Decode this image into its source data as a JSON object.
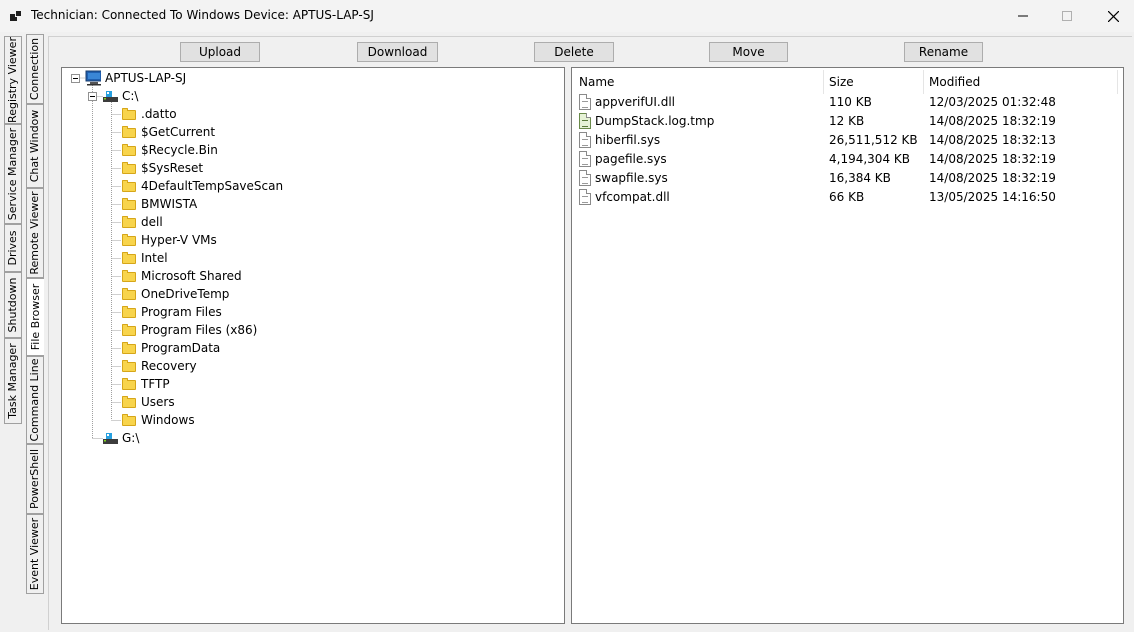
{
  "window": {
    "title": "Technician: Connected To Windows Device: APTUS-LAP-SJ"
  },
  "sidebar": {
    "outer_tabs": [
      "Registry Viewer",
      "Service Manager",
      "Drives",
      "Shutdown",
      "Task Manager"
    ],
    "inner_tabs": [
      "Connection",
      "Chat Window",
      "Remote Viewer",
      "File Browser",
      "Command Line",
      "PowerShell",
      "Event Viewer"
    ]
  },
  "toolbar": {
    "upload_label": "Upload",
    "download_label": "Download",
    "delete_label": "Delete",
    "move_label": "Move",
    "rename_label": "Rename"
  },
  "tree": {
    "root": "APTUS-LAP-SJ",
    "drive_c": "C:\\",
    "folders": [
      ".datto",
      "$GetCurrent",
      "$Recycle.Bin",
      "$SysReset",
      "4DefaultTempSaveScan",
      "BMWISTA",
      "dell",
      "Hyper-V VMs",
      "Intel",
      "Microsoft Shared",
      "OneDriveTemp",
      "Program Files",
      "Program Files (x86)",
      "ProgramData",
      "Recovery",
      "TFTP",
      "Users",
      "Windows"
    ],
    "drive_g": "G:\\"
  },
  "file_list": {
    "columns": [
      "Name",
      "Size",
      "Modified"
    ],
    "rows": [
      {
        "name": "appverifUI.dll",
        "size": "110 KB",
        "modified": "12/03/2025 01:32:48",
        "icon": "dll-file-icon"
      },
      {
        "name": "DumpStack.log.tmp",
        "size": "12 KB",
        "modified": "14/08/2025 18:32:19",
        "icon": "tmp-file-icon"
      },
      {
        "name": "hiberfil.sys",
        "size": "26,511,512 KB",
        "modified": "14/08/2025 18:32:13",
        "icon": "sys-file-icon"
      },
      {
        "name": "pagefile.sys",
        "size": "4,194,304 KB",
        "modified": "14/08/2025 18:32:19",
        "icon": "sys-file-icon"
      },
      {
        "name": "swapfile.sys",
        "size": "16,384 KB",
        "modified": "14/08/2025 18:32:19",
        "icon": "sys-file-icon"
      },
      {
        "name": "vfcompat.dll",
        "size": "66 KB",
        "modified": "13/05/2025 14:16:50",
        "icon": "dll-file-icon"
      }
    ]
  }
}
